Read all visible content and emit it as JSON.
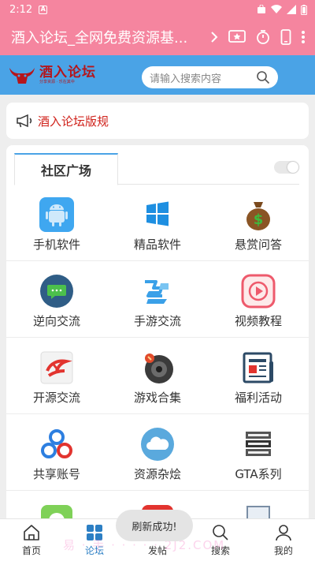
{
  "status_bar": {
    "time": "2:12",
    "notification_letter": "A"
  },
  "app_bar": {
    "title": "酒入论坛_全网免费资源基..."
  },
  "header": {
    "logo_text": "酒入论坛",
    "logo_subtext": "分享资源 · 乐在其中",
    "search_placeholder": "请输入搜索内容"
  },
  "notice": {
    "text": "酒入论坛版规"
  },
  "community": {
    "tab_label": "社区广场",
    "rows": [
      [
        {
          "label": "手机软件",
          "icon": "android-icon"
        },
        {
          "label": "精品软件",
          "icon": "windows-icon"
        },
        {
          "label": "悬赏问答",
          "icon": "money-bag-icon"
        }
      ],
      [
        {
          "label": "逆向交流",
          "icon": "chat-bubble-icon"
        },
        {
          "label": "手游交流",
          "icon": "mobile-game-icon"
        },
        {
          "label": "视频教程",
          "icon": "video-play-icon"
        }
      ],
      [
        {
          "label": "开源交流",
          "icon": "open-source-icon"
        },
        {
          "label": "游戏合集",
          "icon": "game-disc-icon"
        },
        {
          "label": "福利活动",
          "icon": "newspaper-icon"
        }
      ],
      [
        {
          "label": "共享账号",
          "icon": "share-nodes-icon"
        },
        {
          "label": "资源杂烩",
          "icon": "cloud-icon"
        },
        {
          "label": "GTA系列",
          "icon": "gta-logo-icon"
        }
      ]
    ]
  },
  "toast": {
    "text": "刷新成功!"
  },
  "watermark": {
    "text": "易 · 手 · · · · · 2J2.COM"
  },
  "bottom_nav": {
    "items": [
      {
        "label": "首页",
        "icon": "home-icon"
      },
      {
        "label": "论坛",
        "icon": "forum-grid-icon"
      },
      {
        "label": "发帖",
        "icon": "post-icon"
      },
      {
        "label": "搜索",
        "icon": "search-icon"
      },
      {
        "label": "我的",
        "icon": "profile-icon"
      }
    ],
    "active_index": 1
  },
  "colors": {
    "accent_pink": "#f5859f",
    "header_blue": "#4aa3e6",
    "notice_red": "#d0221b",
    "nav_active": "#2c7fc4"
  }
}
